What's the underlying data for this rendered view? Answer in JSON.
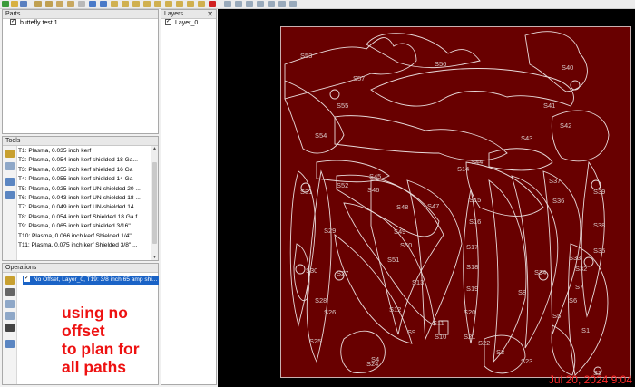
{
  "parts": {
    "title": "Parts",
    "items": [
      {
        "label": "buttefly test 1",
        "checked": true
      }
    ]
  },
  "layers": {
    "title": "Layers",
    "close": "✕",
    "items": [
      {
        "label": "Layer_0",
        "checked": true
      }
    ]
  },
  "tools": {
    "title": "Tools",
    "items": [
      "T1: Plasma, 0.035 inch kerf",
      "T2: Plasma, 0.054 inch  kerf  shielded 18 Ga...",
      "T3: Plasma, 0.055 inch kerf shielded 16 Ga",
      "T4: Plasma, 0.055 inch kerf shielded 14 Ga",
      "T5: Plasma, 0.025 inch kerf UN-shielded 20 ...",
      "T6: Plasma, 0.043 inch kerf UN-shielded 18 ...",
      "T7: Plasma, 0.049 inch kerf UN-shielded 14 ...",
      "T8: Plasma, 0.054 inch kerf Shielded 18 Ga f...",
      "T9: Plasma, 0.065 inch kerf shielded 3/16\" ...",
      "T10: Plasma, 0.066 inch kerf Shielded 1/4\" ...",
      "T11: Plasma, 0.075 inch kerf Shielded 3/8\" ..."
    ]
  },
  "operations": {
    "title": "Operations",
    "items": [
      {
        "label": "No Offset, Layer_0, T19: 3/8 inch 65 amp shi...",
        "checked": true,
        "selected": true
      }
    ]
  },
  "annotation": {
    "lines": [
      "using no offset",
      "to plan for",
      "all paths"
    ],
    "color": "#ee1111"
  },
  "canvas": {
    "timestamp": "Jul 20, 2024 9:04",
    "sheet_color": "#680000",
    "part_labels": [
      "S1",
      "S2",
      "S3",
      "S4",
      "S5",
      "S6",
      "S7",
      "S8",
      "S9",
      "S10",
      "S11",
      "S12",
      "S13",
      "S14",
      "S15",
      "S16",
      "S17",
      "S18",
      "S19",
      "S20",
      "S21",
      "S22",
      "S23",
      "S24",
      "S25",
      "S26",
      "S27",
      "S28",
      "S29",
      "S30",
      "S31",
      "S32",
      "S33",
      "S34",
      "S35",
      "S36",
      "S37",
      "S38",
      "S39",
      "S40",
      "S41",
      "S42",
      "S43",
      "S44",
      "S45",
      "S46",
      "S47",
      "S48",
      "S49",
      "S50",
      "S51",
      "S52",
      "S53",
      "S54",
      "S55",
      "S56",
      "S57"
    ]
  }
}
